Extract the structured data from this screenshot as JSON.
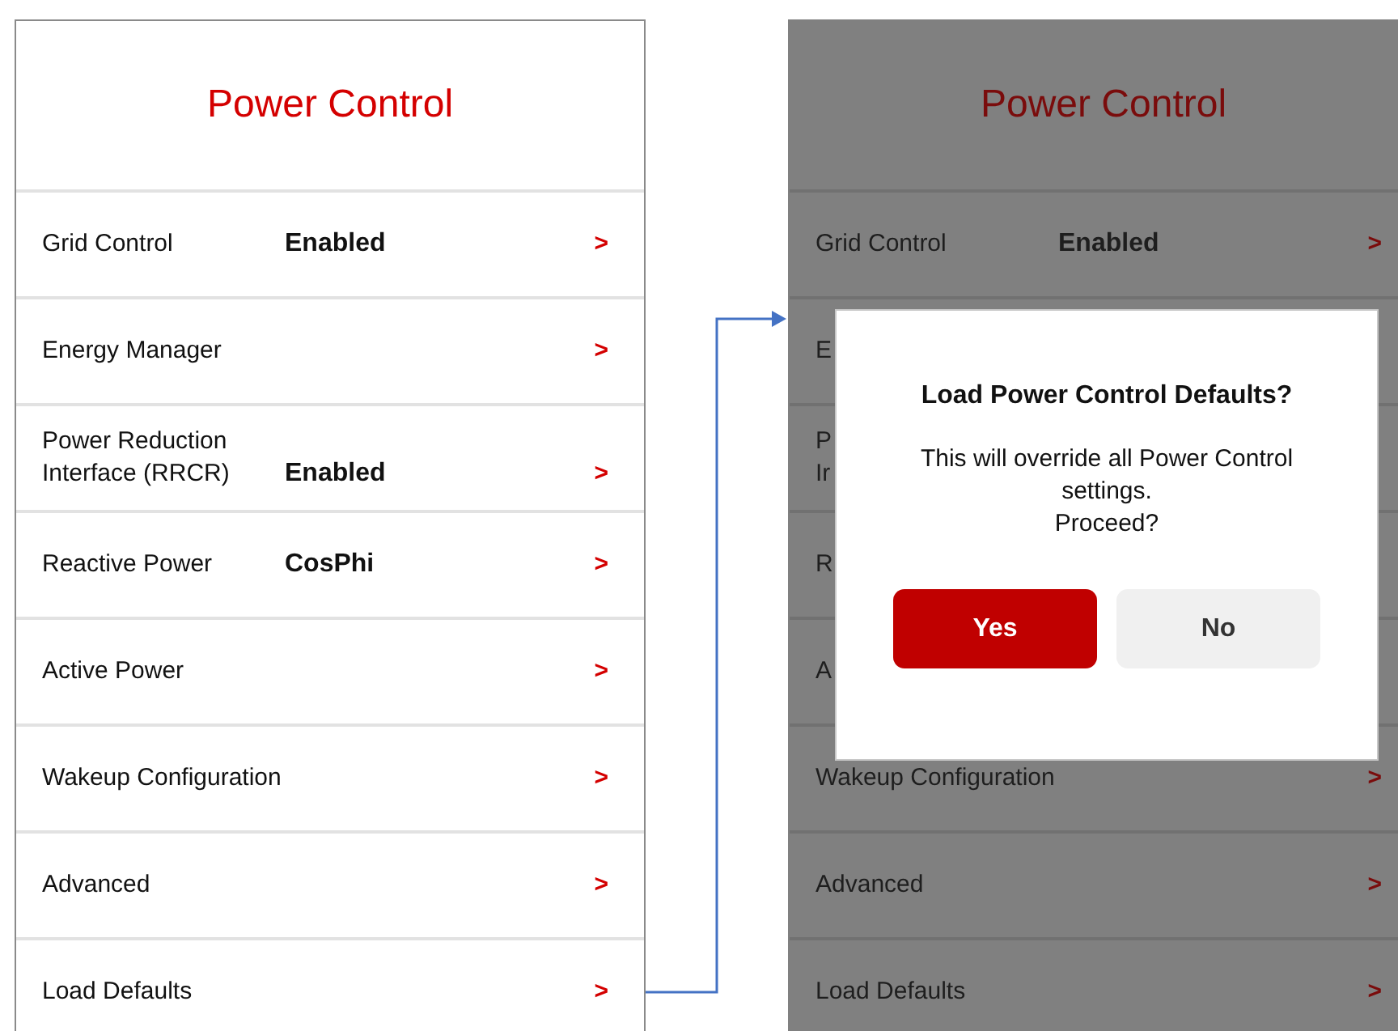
{
  "panels": [
    {
      "dimmed": false,
      "title": "Power Control",
      "rows": [
        {
          "label": "Grid Control",
          "value": "Enabled",
          "chevron": ">"
        },
        {
          "label": "Energy Manager",
          "chevron": ">"
        },
        {
          "label": "Power Reduction Interface (RRCR)",
          "value": "Enabled",
          "chevron": ">"
        },
        {
          "label": "Reactive Power",
          "value": "CosPhi",
          "chevron": ">"
        },
        {
          "label": "Active Power",
          "chevron": ">"
        },
        {
          "label": "Wakeup Configuration",
          "chevron": ">"
        },
        {
          "label": "Advanced",
          "chevron": ">"
        },
        {
          "label": "Load Defaults",
          "chevron": ">"
        }
      ]
    },
    {
      "dimmed": true,
      "title": "Power Control",
      "rows": [
        {
          "label": "Grid Control",
          "value": "Enabled",
          "chevron": ">"
        },
        {
          "label": "E"
        },
        {
          "label": "P\nIr"
        },
        {
          "label": "R"
        },
        {
          "label": "A"
        },
        {
          "label": "Wakeup Configuration",
          "chevron": ">"
        },
        {
          "label": "Advanced",
          "chevron": ">"
        },
        {
          "label": "Load Defaults",
          "chevron": ">"
        }
      ],
      "dialog": {
        "title": "Load Power Control Defaults?",
        "message": "This will override all Power Control settings.\nProceed?",
        "buttons": [
          {
            "label": "Yes",
            "kind": "primary"
          },
          {
            "label": "No",
            "kind": "secondary"
          }
        ]
      }
    }
  ],
  "connector": {
    "kind": "arrow"
  }
}
